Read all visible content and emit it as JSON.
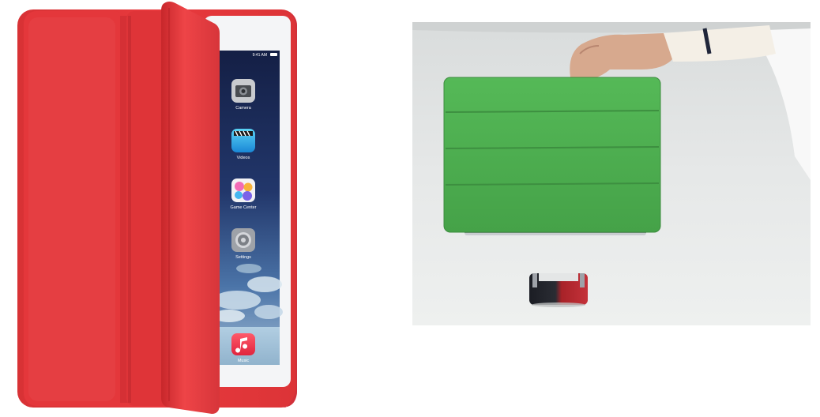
{
  "left_photo": {
    "status_time": "9:41 AM",
    "apps": [
      {
        "label": "Camera",
        "icon": "camera-icon"
      },
      {
        "label": "Videos",
        "icon": "videos-icon"
      },
      {
        "label": "Game Center",
        "icon": "game-center-icon"
      },
      {
        "label": "Settings",
        "icon": "settings-icon"
      }
    ],
    "dock_apps": [
      {
        "label": "Music",
        "icon": "music-icon"
      }
    ],
    "colors": {
      "case_red": "#e8393d",
      "case_red_dark": "#c92a2f",
      "screen_blue": "#1c2f63"
    }
  },
  "right_photo": {
    "colors": {
      "cover_green": "#4caf4f",
      "backdrop": "#e4e6e6",
      "magnet_red": "#b0242a",
      "magnet_dark": "#1b1d24"
    }
  }
}
